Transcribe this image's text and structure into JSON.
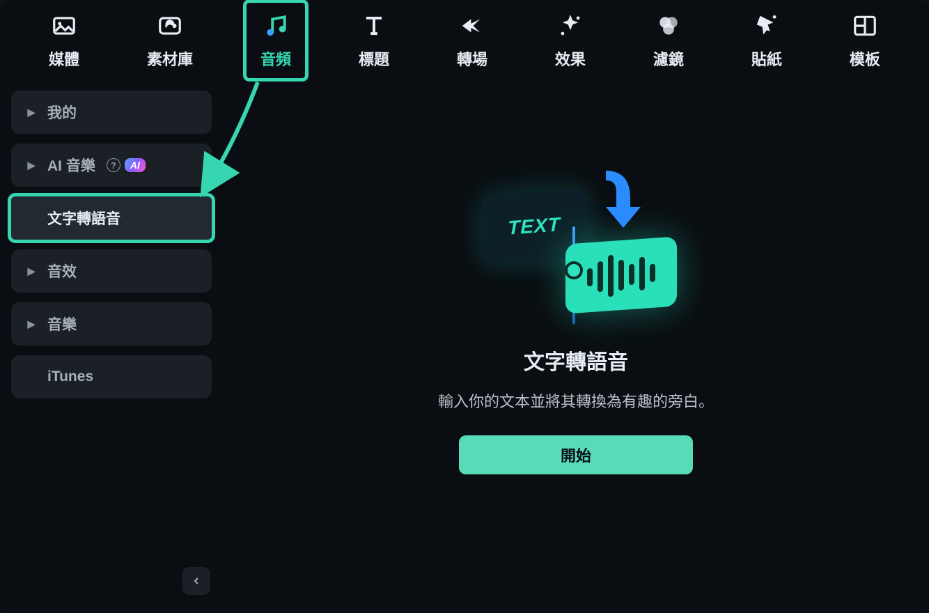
{
  "topTabs": [
    {
      "id": "media",
      "label": "媒體"
    },
    {
      "id": "library",
      "label": "素材庫"
    },
    {
      "id": "audio",
      "label": "音頻",
      "active": true
    },
    {
      "id": "title",
      "label": "標題"
    },
    {
      "id": "transition",
      "label": "轉場"
    },
    {
      "id": "effect",
      "label": "效果"
    },
    {
      "id": "filter",
      "label": "濾鏡"
    },
    {
      "id": "sticker",
      "label": "貼紙"
    },
    {
      "id": "template",
      "label": "模板"
    }
  ],
  "sidebar": {
    "items": [
      {
        "id": "mine",
        "label": "我的",
        "hasChevron": true
      },
      {
        "id": "ai-music",
        "label": "AI 音樂",
        "hasChevron": true,
        "aiBadge": true
      },
      {
        "id": "tts",
        "label": "文字轉語音",
        "hasChevron": false,
        "active": true
      },
      {
        "id": "sfx",
        "label": "音效",
        "hasChevron": true
      },
      {
        "id": "music",
        "label": "音樂",
        "hasChevron": true
      },
      {
        "id": "itunes",
        "label": "iTunes",
        "hasChevron": false
      }
    ],
    "aiBadgeText": "AI"
  },
  "hero": {
    "title": "文字轉語音",
    "subtitle": "輸入你的文本並將其轉換為有趣的旁白。",
    "button": "開始",
    "illustrationText": "TEXT"
  },
  "colors": {
    "accent": "#35d6b0"
  }
}
